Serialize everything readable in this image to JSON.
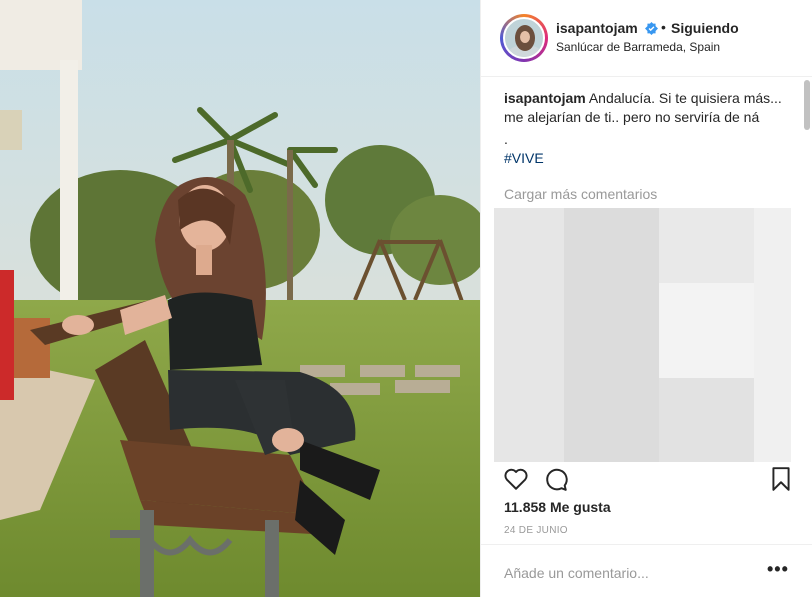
{
  "header": {
    "username": "isapantojam",
    "separator": "•",
    "follow_status": "Siguiendo",
    "location": "Sanlúcar de Barrameda, Spain",
    "verified_icon": "verified-badge-icon"
  },
  "caption": {
    "username": "isapantojam",
    "text": "Andalucía. Si te quisiera más... me alejarían de ti.. pero no serviría de ná",
    "dot": ".",
    "hashtag": "#VIVE"
  },
  "load_more": "Cargar más comentarios",
  "actions": {
    "like_icon": "heart-icon",
    "comment_icon": "comment-icon",
    "save_icon": "bookmark-icon"
  },
  "likes": "11.858 Me gusta",
  "date": "24 DE JUNIO",
  "add_comment": {
    "placeholder": "Añade un comentario...",
    "more_icon": "more-options-icon",
    "more_label": "•••"
  },
  "colors": {
    "text": "#262626",
    "muted": "#999999",
    "hashtag": "#003569",
    "verified": "#3897f0",
    "divider": "#efefef"
  }
}
